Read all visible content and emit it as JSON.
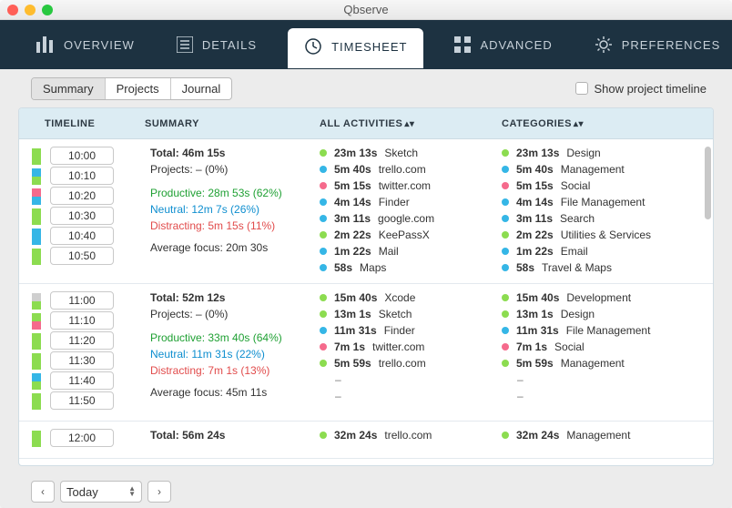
{
  "title": "Qbserve",
  "nav": {
    "overview": "OVERVIEW",
    "details": "DETAILS",
    "timesheet": "TIMESHEET",
    "advanced": "ADVANCED",
    "preferences": "PREFERENCES"
  },
  "segments": {
    "summary": "Summary",
    "projects": "Projects",
    "journal": "Journal"
  },
  "show_timeline_label": "Show project timeline",
  "columns": {
    "timeline": "TIMELINE",
    "summary": "SUMMARY",
    "activities": "ALL ACTIVITIES",
    "categories": "CATEGORIES"
  },
  "footer": {
    "prev": "‹",
    "next": "›",
    "range": "Today"
  },
  "colors": {
    "productive": "#8cdc50",
    "neutral": "#35b6e6",
    "distracting": "#f56a8c",
    "grey": "#cfcfcf"
  },
  "rows": [
    {
      "bands": [
        "productive",
        "productive",
        "neutral",
        "productive",
        "distracting",
        "neutral",
        "productive",
        "productive",
        "neutral",
        "neutral",
        "productive",
        "productive"
      ],
      "times": [
        "10:00",
        "10:10",
        "10:20",
        "10:30",
        "10:40",
        "10:50"
      ],
      "summary": {
        "total": "Total: 46m 15s",
        "projects": "Projects: – (0%)",
        "productive": "Productive: 28m 53s (62%)",
        "neutral": "Neutral: 12m 7s (26%)",
        "distracting": "Distracting: 5m 15s (11%)",
        "avg": "Average focus: 20m 30s"
      },
      "activities": [
        {
          "c": "green",
          "d": "23m 13s",
          "t": "Sketch"
        },
        {
          "c": "blue",
          "d": "5m 40s",
          "t": "trello.com"
        },
        {
          "c": "pink",
          "d": "5m 15s",
          "t": "twitter.com"
        },
        {
          "c": "blue",
          "d": "4m 14s",
          "t": "Finder"
        },
        {
          "c": "blue",
          "d": "3m 11s",
          "t": "google.com"
        },
        {
          "c": "green",
          "d": "2m 22s",
          "t": "KeePassX"
        },
        {
          "c": "blue",
          "d": "1m 22s",
          "t": "Mail"
        },
        {
          "c": "blue",
          "d": "58s",
          "t": "Maps"
        }
      ],
      "categories": [
        {
          "c": "green",
          "d": "23m 13s",
          "t": "Design"
        },
        {
          "c": "blue",
          "d": "5m 40s",
          "t": "Management"
        },
        {
          "c": "pink",
          "d": "5m 15s",
          "t": "Social"
        },
        {
          "c": "blue",
          "d": "4m 14s",
          "t": "File Management"
        },
        {
          "c": "blue",
          "d": "3m 11s",
          "t": "Search"
        },
        {
          "c": "green",
          "d": "2m 22s",
          "t": "Utilities & Services"
        },
        {
          "c": "blue",
          "d": "1m 22s",
          "t": "Email"
        },
        {
          "c": "blue",
          "d": "58s",
          "t": "Travel & Maps"
        }
      ]
    },
    {
      "bands": [
        "grey",
        "productive",
        "productive",
        "distracting",
        "productive",
        "productive",
        "productive",
        "productive",
        "neutral",
        "productive",
        "productive",
        "productive"
      ],
      "times": [
        "11:00",
        "11:10",
        "11:20",
        "11:30",
        "11:40",
        "11:50"
      ],
      "summary": {
        "total": "Total: 52m 12s",
        "projects": "Projects: – (0%)",
        "productive": "Productive: 33m 40s (64%)",
        "neutral": "Neutral: 11m 31s (22%)",
        "distracting": "Distracting: 7m 1s (13%)",
        "avg": "Average focus: 45m 11s"
      },
      "activities": [
        {
          "c": "green",
          "d": "15m 40s",
          "t": "Xcode"
        },
        {
          "c": "green",
          "d": "13m 1s",
          "t": "Sketch"
        },
        {
          "c": "blue",
          "d": "11m 31s",
          "t": "Finder"
        },
        {
          "c": "pink",
          "d": "7m 1s",
          "t": "twitter.com"
        },
        {
          "c": "green",
          "d": "5m 59s",
          "t": "trello.com"
        },
        {
          "dash": true
        },
        {
          "dash": true
        }
      ],
      "categories": [
        {
          "c": "green",
          "d": "15m 40s",
          "t": "Development"
        },
        {
          "c": "green",
          "d": "13m 1s",
          "t": "Design"
        },
        {
          "c": "blue",
          "d": "11m 31s",
          "t": "File Management"
        },
        {
          "c": "pink",
          "d": "7m 1s",
          "t": "Social"
        },
        {
          "c": "green",
          "d": "5m 59s",
          "t": "Management"
        },
        {
          "dash": true
        },
        {
          "dash": true
        }
      ]
    },
    {
      "bands": [
        "productive",
        "productive"
      ],
      "times": [
        "12:00"
      ],
      "summary": {
        "total": "Total: 56m 24s",
        "projects": "",
        "productive": "",
        "neutral": "",
        "distracting": "",
        "avg": ""
      },
      "activities": [
        {
          "c": "green",
          "d": "32m 24s",
          "t": "trello.com"
        }
      ],
      "categories": [
        {
          "c": "green",
          "d": "32m 24s",
          "t": "Management"
        }
      ]
    }
  ]
}
